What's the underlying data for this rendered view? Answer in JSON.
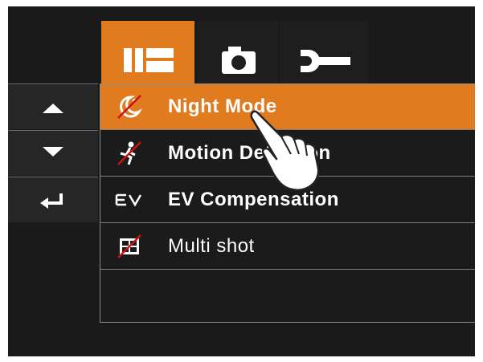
{
  "tabs": [
    {
      "icon": "video-mode-icon",
      "active": true
    },
    {
      "icon": "camera-icon",
      "active": false
    },
    {
      "icon": "wrench-icon",
      "active": false
    }
  ],
  "side_buttons": [
    {
      "icon": "arrow-up-icon"
    },
    {
      "icon": "arrow-down-icon"
    },
    {
      "icon": "return-icon"
    }
  ],
  "menu": {
    "items": [
      {
        "label": "Night Mode",
        "icon": "night-mode-icon",
        "selected": true
      },
      {
        "label": "Motion Detection",
        "icon": "motion-detection-icon",
        "selected": false
      },
      {
        "label": "EV Compensation",
        "icon": "ev-icon",
        "selected": false
      },
      {
        "label": "Multi shot",
        "icon": "multi-shot-icon",
        "selected": false
      }
    ]
  },
  "colors": {
    "accent": "#e07b1f",
    "background": "#1a1a1a",
    "text": "#ffffff"
  }
}
